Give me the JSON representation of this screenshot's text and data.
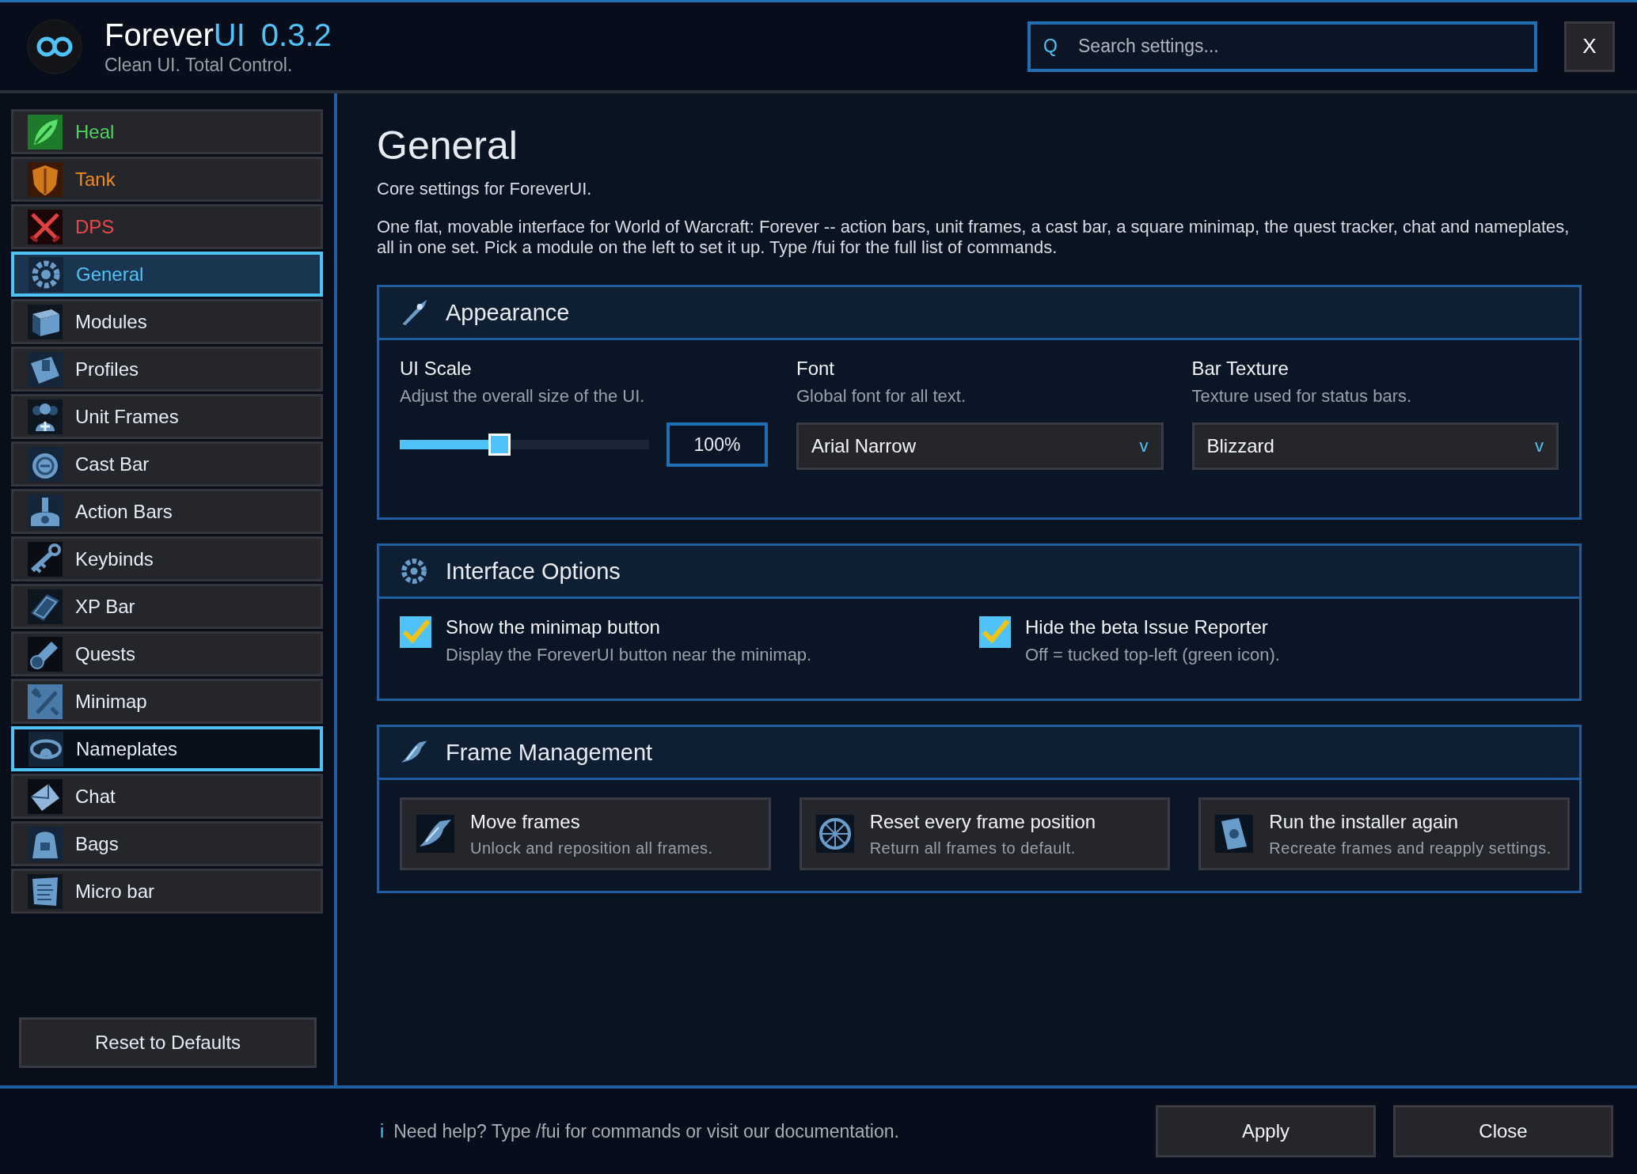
{
  "header": {
    "brand": "Forever",
    "brand_accent": "UI",
    "version": "0.3.2",
    "tagline": "Clean UI. Total Control.",
    "search": {
      "icon": "Q",
      "placeholder": "Search settings..."
    },
    "close_label": "X"
  },
  "sidebar": {
    "items": [
      {
        "label": "Heal",
        "selected": false,
        "hovered": false,
        "color": "#4cd55a"
      },
      {
        "label": "Tank",
        "selected": false,
        "hovered": false,
        "color": "#f08a1c"
      },
      {
        "label": "DPS",
        "selected": false,
        "hovered": false,
        "color": "#e84848"
      },
      {
        "label": "General",
        "selected": true,
        "hovered": false
      },
      {
        "label": "Modules",
        "selected": false,
        "hovered": false
      },
      {
        "label": "Profiles",
        "selected": false,
        "hovered": false
      },
      {
        "label": "Unit Frames",
        "selected": false,
        "hovered": false
      },
      {
        "label": "Cast Bar",
        "selected": false,
        "hovered": false
      },
      {
        "label": "Action Bars",
        "selected": false,
        "hovered": false
      },
      {
        "label": "Keybinds",
        "selected": false,
        "hovered": false
      },
      {
        "label": "XP Bar",
        "selected": false,
        "hovered": false
      },
      {
        "label": "Quests",
        "selected": false,
        "hovered": false
      },
      {
        "label": "Minimap",
        "selected": false,
        "hovered": false
      },
      {
        "label": "Nameplates",
        "selected": false,
        "hovered": true
      },
      {
        "label": "Chat",
        "selected": false,
        "hovered": false
      },
      {
        "label": "Bags",
        "selected": false,
        "hovered": false
      },
      {
        "label": "Micro bar",
        "selected": false,
        "hovered": false
      }
    ],
    "reset_button": "Reset to Defaults"
  },
  "page": {
    "title": "General",
    "subtitle": "Core settings for ForeverUI.",
    "description": "One flat, movable interface for World of Warcraft: Forever -- action bars, unit frames, a cast bar, a square minimap, the quest tracker, chat and nameplates, all in one set. Pick a module on the left to set it up. Type /fui for the full list of commands.",
    "sections": [
      {
        "kind": "appearance",
        "title": "Appearance",
        "settings": [
          {
            "kind": "slider",
            "label": "UI Scale",
            "hint": "Adjust the overall size of the UI.",
            "level": 0.4,
            "value": "100%"
          },
          {
            "kind": "dropdown",
            "label": "Font",
            "hint": "Global font for all text.",
            "value": "Arial Narrow",
            "chevron": "v"
          },
          {
            "kind": "dropdown",
            "label": "Bar Texture",
            "hint": "Texture used for status bars.",
            "value": "Blizzard",
            "chevron": "v"
          }
        ]
      },
      {
        "kind": "options",
        "title": "Interface Options",
        "settings": [
          {
            "kind": "checkbox",
            "label": "Show the minimap button",
            "hint": "Display the ForeverUI button near the minimap.",
            "checked": true
          },
          {
            "kind": "checkbox",
            "label": "Hide the beta Issue Reporter",
            "hint": "Off = tucked top-left (green icon).",
            "checked": true
          }
        ]
      },
      {
        "kind": "actions",
        "title": "Frame Management",
        "settings": [
          {
            "kind": "action",
            "label": "Move frames",
            "hint": "Unlock and reposition all frames."
          },
          {
            "kind": "action",
            "label": "Reset every frame position",
            "hint": "Return all frames to default."
          },
          {
            "kind": "action",
            "label": "Run the installer again",
            "hint": "Recreate frames and reapply settings."
          }
        ]
      }
    ]
  },
  "footer": {
    "info_icon": "i",
    "help": "Need help? Type /fui for commands or visit our documentation.",
    "buttons": [
      "Apply",
      "Close"
    ]
  }
}
